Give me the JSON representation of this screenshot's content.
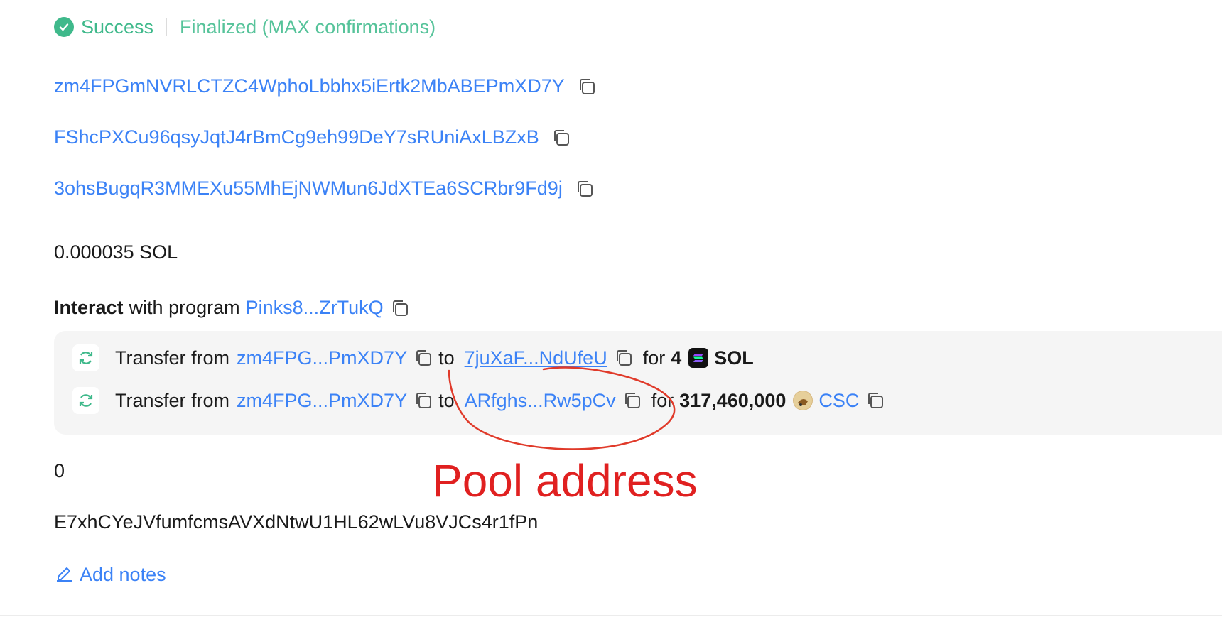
{
  "status": {
    "result": "Success",
    "confirmation": "Finalized (MAX confirmations)"
  },
  "accounts": [
    "zm4FPGmNVRLCTZC4WphoLbbhx5iErtk2MbABEPmXD7Y",
    "FShcPXCu96qsyJqtJ4rBmCg9eh99DeY7sRUniAxLBZxB",
    "3ohsBugqR3MMEXu55MhEjNWMun6JdXTEa6SCRbr9Fd9j"
  ],
  "fee": "0.000035 SOL",
  "interact": {
    "verb": "Interact",
    "text": "with program",
    "program": "Pinks8...ZrTukQ"
  },
  "transfers": [
    {
      "label": "Transfer from",
      "from": "zm4FPG...PmXD7Y",
      "to_word": "to",
      "to": "7juXaF...NdUfeU",
      "for_word": "for",
      "amount": "4",
      "token": "SOL"
    },
    {
      "label": "Transfer from",
      "from": "zm4FPG...PmXD7Y",
      "to_word": "to",
      "to": "ARfghs...Rw5pCv",
      "for_word": "for",
      "amount": "317,460,000",
      "token": "CSC"
    }
  ],
  "compute": "0",
  "blockhash": "E7xhCYeJVfumfcmsAVXdNtwU1HL62wLVu8VJCs4r1fPn",
  "notes_label": "Add notes",
  "annotation": "Pool address",
  "colors": {
    "link": "#3b82f6",
    "success": "#3fb98b",
    "annotation": "#e02020"
  },
  "icons": [
    "check-circle-icon",
    "copy-icon",
    "refresh-icon",
    "solana-icon",
    "csc-token-icon",
    "pencil-icon"
  ]
}
